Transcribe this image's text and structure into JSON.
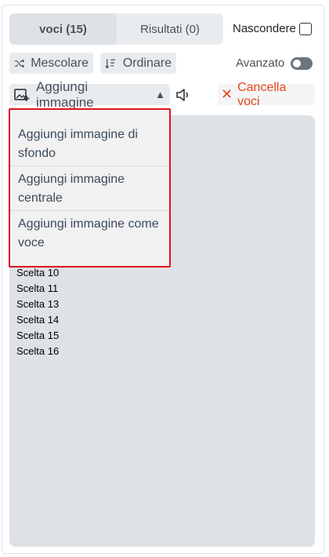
{
  "tabs": {
    "entries_label": "voci (15)",
    "results_label": "Risultati (0)"
  },
  "hide": {
    "label": "Nascondere",
    "checked": false
  },
  "toolbar": {
    "shuffle_label": "Mescolare",
    "sort_label": "Ordinare",
    "advanced_label": "Avanzato",
    "advanced_on": false,
    "add_image_label": "Aggiungi immagine",
    "add_image_caret": "▲",
    "clear_label": "Cancella voci",
    "clear_icon": "✕"
  },
  "dropdown": {
    "items": [
      "Aggiungi immagine di sfondo",
      "Aggiungi immagine centrale",
      "Aggiungi immagine come voce"
    ]
  },
  "entries": {
    "visible_lines": [
      "Scelta 10",
      "Scelta 11",
      "Scelta 13",
      "Scelta 14",
      "Scelta 15",
      "Scelta 16"
    ]
  },
  "colors": {
    "accent_red": "#e8491d",
    "highlight_border": "#e0141a"
  }
}
